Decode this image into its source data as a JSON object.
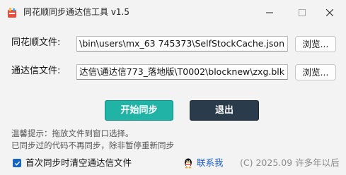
{
  "window": {
    "title": "同花顺同步通达信工具 v1.5",
    "icon": "app-logo-icon",
    "controls": [
      "minimize-icon",
      "maximize-icon",
      "close-icon"
    ]
  },
  "rows": [
    {
      "label": "同花顺文件:",
      "value": "\\bin\\users\\mx_63   745373\\SelfStockCache.json",
      "browse_label": "浏览..."
    },
    {
      "label": "通达信文件:",
      "value": "达信\\通达信773_落地版\\T0002\\blocknew\\zxg.blk",
      "browse_label": "浏览..."
    }
  ],
  "actions": {
    "start_label": "开始同步",
    "exit_label": "退出"
  },
  "tips": [
    "温馨提示：拖放文件到窗口选择。",
    "已同步过的代码不再同步，除非暂停重新同步"
  ],
  "footer": {
    "checkbox_label": "首次同步时清空通达信文件",
    "checkbox_checked": true,
    "contact_label": "联系我",
    "contact_icon": "qq-penguin-icon",
    "copyright": "(C) 2025.09 许多年以后"
  },
  "colors": {
    "start_button": "#22b3a7",
    "exit_button": "#2a3b4c",
    "link": "#1a5fd1",
    "checkbox": "#1565c0"
  }
}
